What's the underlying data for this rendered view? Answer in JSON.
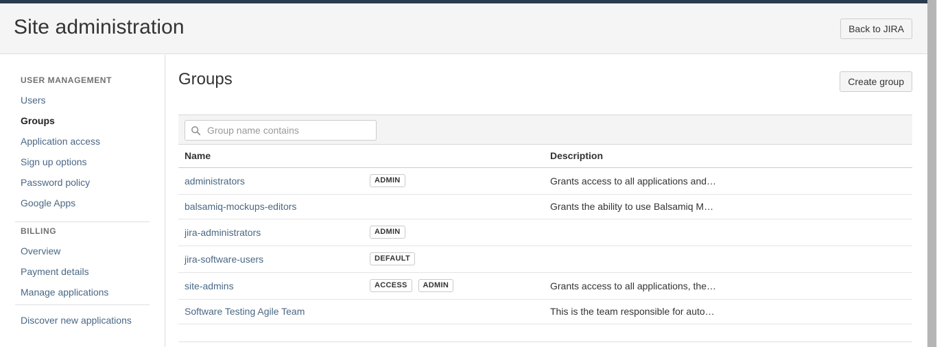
{
  "header": {
    "title": "Site administration",
    "back_button": "Back to JIRA"
  },
  "sidebar": {
    "sections": [
      {
        "heading": "USER MANAGEMENT",
        "items": [
          {
            "label": "Users",
            "active": false
          },
          {
            "label": "Groups",
            "active": true
          },
          {
            "label": "Application access",
            "active": false
          },
          {
            "label": "Sign up options",
            "active": false
          },
          {
            "label": "Password policy",
            "active": false
          },
          {
            "label": "Google Apps",
            "active": false
          }
        ]
      },
      {
        "heading": "BILLING",
        "items": [
          {
            "label": "Overview",
            "active": false
          },
          {
            "label": "Payment details",
            "active": false
          },
          {
            "label": "Manage applications",
            "active": false
          }
        ]
      }
    ],
    "footer_links": [
      {
        "label": "Discover new applications"
      }
    ]
  },
  "main": {
    "title": "Groups",
    "create_button": "Create group",
    "search": {
      "placeholder": "Group name contains",
      "value": "",
      "icon": "search-icon"
    },
    "table": {
      "columns": [
        "Name",
        "Description"
      ],
      "rows": [
        {
          "name": "administrators",
          "badges": [
            "ADMIN"
          ],
          "description": "Grants access to all applications and…"
        },
        {
          "name": "balsamiq-mockups-editors",
          "badges": [],
          "description": "Grants the ability to use Balsamiq M…"
        },
        {
          "name": "jira-administrators",
          "badges": [
            "ADMIN"
          ],
          "description": ""
        },
        {
          "name": "jira-software-users",
          "badges": [
            "DEFAULT"
          ],
          "description": ""
        },
        {
          "name": "site-admins",
          "badges": [
            "ACCESS",
            "ADMIN"
          ],
          "description": "Grants access to all applications, the…"
        },
        {
          "name": "Software Testing Agile Team",
          "badges": [],
          "description": "This is the team responsible for auto…"
        }
      ]
    }
  },
  "colors": {
    "link": "#4a6785",
    "top_strip": "#2b3b4d",
    "header_bg": "#f5f5f5",
    "toolbar_bg": "#f4f4f4"
  }
}
